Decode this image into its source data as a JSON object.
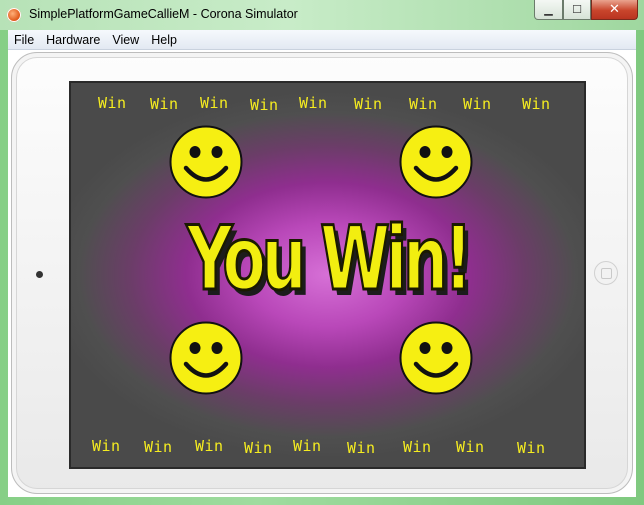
{
  "window": {
    "title": "SimplePlatformGameCallieM - Corona Simulator",
    "min_label": "▁",
    "max_label": "☐",
    "close_label": "✕"
  },
  "menu": [
    "File",
    "Hardware",
    "View",
    "Help"
  ],
  "game": {
    "headline": "You Win!",
    "top_row": [
      "Win",
      "Win",
      "Win",
      "Win",
      "Win",
      "Win",
      "Win",
      "Win",
      "Win"
    ],
    "bottom_row": [
      "Win",
      "Win",
      "Win",
      "Win",
      "Win",
      "Win",
      "Win",
      "Win",
      "Win"
    ],
    "smiley_color": "#f6ef12",
    "text_color": "#f5ec20",
    "background_center": "#d670d6",
    "background_edge": "#4a4a4a",
    "icons": [
      "smiley-icon",
      "smiley-icon",
      "smiley-icon",
      "smiley-icon"
    ]
  }
}
